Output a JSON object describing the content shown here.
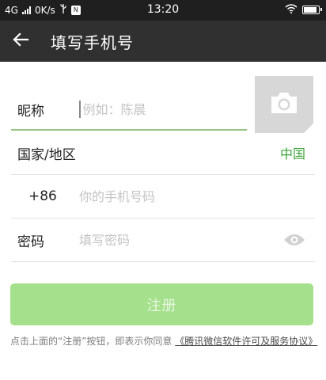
{
  "status_bar": {
    "network": "4G",
    "speed": "0K/s",
    "sim_label": "N",
    "time": "13:20",
    "icons": [
      "signal-icon",
      "usb-icon",
      "sim-icon",
      "wifi-icon",
      "battery-icon"
    ]
  },
  "header": {
    "title": "填写手机号",
    "back_icon": "arrow-left-icon"
  },
  "form": {
    "nickname": {
      "label": "昵称",
      "placeholder": "例如：陈晨",
      "value": ""
    },
    "avatar": {
      "icon": "camera-icon"
    },
    "region": {
      "label": "国家/地区",
      "value": "中国"
    },
    "phone": {
      "country_code": "+86",
      "placeholder": "你的手机号码",
      "value": ""
    },
    "password": {
      "label": "密码",
      "placeholder": "填写密码",
      "value": "",
      "toggle_icon": "eye-icon"
    }
  },
  "register_button": {
    "label": "注册"
  },
  "agreement": {
    "text": "点击上面的“注册”按钮，即表示你同意",
    "link": "《腾讯微信软件许可及服务协议》"
  },
  "colors": {
    "status_bar_bg": "#1f1f1f",
    "title_bar_bg": "#303030",
    "accent_green": "#3ea33b",
    "button_green": "#a5e08c"
  }
}
